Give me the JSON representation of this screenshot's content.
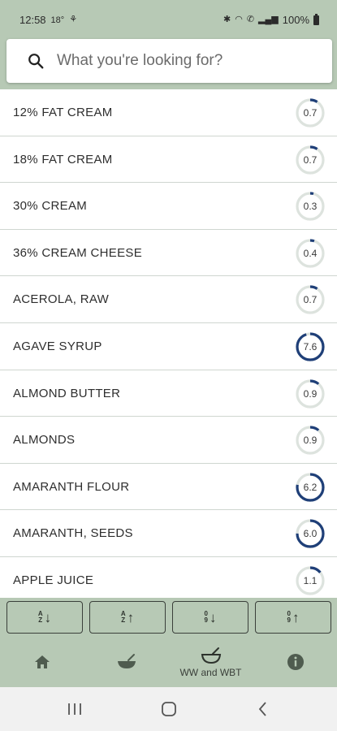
{
  "status_bar": {
    "time": "12:58",
    "temperature": "18°",
    "battery": "100%"
  },
  "search": {
    "placeholder": "What you're looking for?",
    "value": ""
  },
  "colors": {
    "theme": "#b7c9b5",
    "ring_track": "#dde3de",
    "ring_fill": "#1f3f78",
    "divider": "#cfd6d0"
  },
  "foods": [
    {
      "name": "12% FAT CREAM",
      "score": "0.7",
      "fill": 0.09
    },
    {
      "name": "18% FAT CREAM",
      "score": "0.7",
      "fill": 0.09
    },
    {
      "name": "30% CREAM",
      "score": "0.3",
      "fill": 0.04
    },
    {
      "name": "36% CREAM CHEESE",
      "score": "0.4",
      "fill": 0.05
    },
    {
      "name": "ACEROLA, RAW",
      "score": "0.7",
      "fill": 0.09
    },
    {
      "name": "AGAVE SYRUP",
      "score": "7.6",
      "fill": 0.95
    },
    {
      "name": "ALMOND BUTTER",
      "score": "0.9",
      "fill": 0.11
    },
    {
      "name": "ALMONDS",
      "score": "0.9",
      "fill": 0.11
    },
    {
      "name": "AMARANTH FLOUR",
      "score": "6.2",
      "fill": 0.78
    },
    {
      "name": "AMARANTH, SEEDS",
      "score": "6.0",
      "fill": 0.75
    },
    {
      "name": "APPLE JUICE",
      "score": "1.1",
      "fill": 0.14
    }
  ],
  "sort_buttons": [
    {
      "top": "A",
      "bottom": "Z",
      "arrow": "↓",
      "icon": "sort-alpha-asc-icon"
    },
    {
      "top": "A",
      "bottom": "Z",
      "arrow": "↑",
      "icon": "sort-alpha-desc-icon"
    },
    {
      "top": "0",
      "bottom": "9",
      "arrow": "↓",
      "icon": "sort-numeric-asc-icon"
    },
    {
      "top": "0",
      "bottom": "9",
      "arrow": "↑",
      "icon": "sort-numeric-desc-icon"
    }
  ],
  "bottom_nav": {
    "items": [
      {
        "icon": "home-icon",
        "label": ""
      },
      {
        "icon": "bowl-icon",
        "label": ""
      },
      {
        "icon": "ww-wbt-bowl-icon",
        "label": "WW and WBT"
      },
      {
        "icon": "info-icon",
        "label": ""
      }
    ]
  },
  "system_nav": {
    "items": [
      {
        "icon": "recent-apps-icon"
      },
      {
        "icon": "home-circle-icon"
      },
      {
        "icon": "back-icon"
      }
    ]
  }
}
